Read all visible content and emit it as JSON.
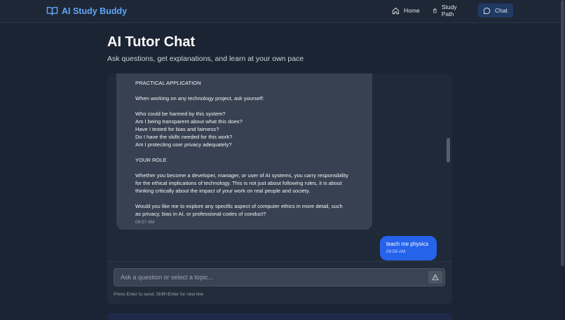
{
  "header": {
    "brand": "AI Study Buddy",
    "nav": [
      {
        "label": "Home",
        "icon": "home-icon"
      },
      {
        "label": "Study Path",
        "icon": "clipboard-icon"
      },
      {
        "label": "Chat",
        "icon": "chat-bubble-icon",
        "active": true
      }
    ]
  },
  "page": {
    "title": "AI Tutor Chat",
    "subtitle": "Ask questions, get explanations, and learn at your own pace"
  },
  "messages": [
    {
      "role": "assistant",
      "lines": [
        "PRACTICAL APPLICATION",
        "",
        "When working on any technology project, ask yourself:",
        "",
        "Who could be harmed by this system?",
        "Am I being transparent about what this does?",
        "Have I tested for bias and fairness?",
        "Do I have the skills needed for this work?",
        "Am I protecting user privacy adequately?",
        "",
        "YOUR ROLE",
        "",
        "Whether you become a developer, manager, or user of AI systems, you carry responsibility",
        "for the ethical implications of technology. This is not just about following rules, it is about",
        "thinking critically about the impact of your work on real people and society.",
        "",
        "Would you like me to explore any specific aspect of computer ethics in more detail, such",
        "as privacy, bias in AI, or professional codes of conduct?"
      ],
      "time": "09:57 AM"
    },
    {
      "role": "user",
      "text": "teach me physics",
      "time": "09:58 AM"
    }
  ],
  "input": {
    "placeholder": "Ask a question or select a topic...",
    "value": "",
    "hint": "Press Enter to send, Shift+Enter for new line",
    "send_icon": "send-icon"
  },
  "colors": {
    "accent": "#60a5fa",
    "user_bubble": "#2563eb",
    "ai_bubble": "#374151",
    "background": "#1b2433"
  }
}
